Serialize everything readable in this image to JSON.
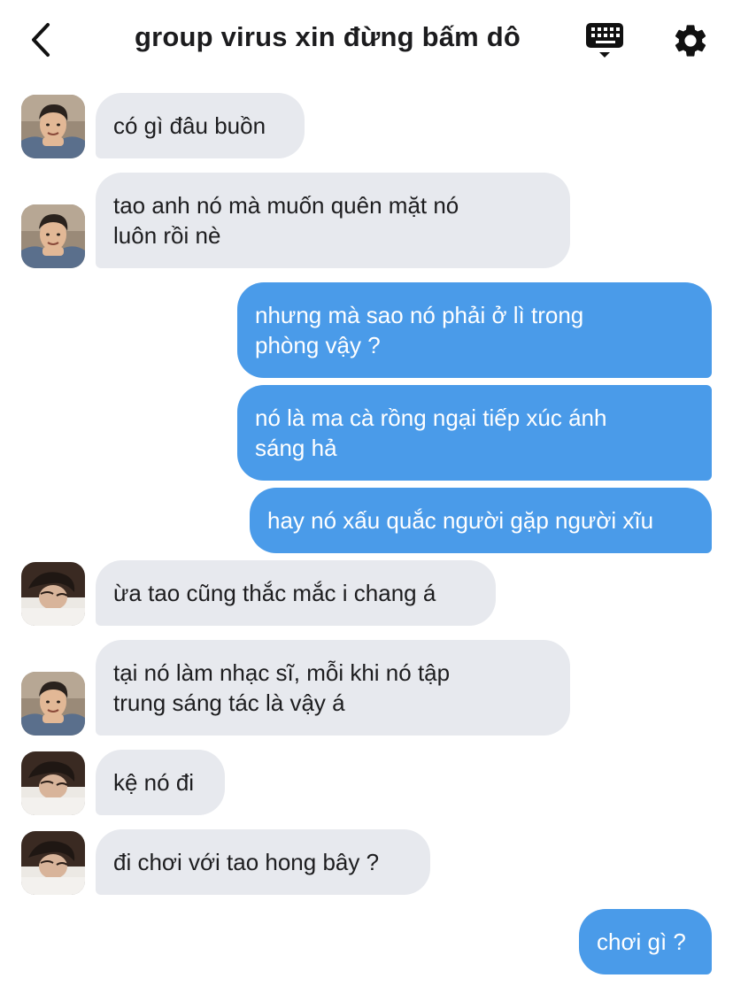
{
  "header": {
    "title": "group virus xin đừng bấm dô",
    "back_icon": "chevron-left-icon",
    "keyboard_icon": "keyboard-icon",
    "settings_icon": "gear-icon"
  },
  "colors": {
    "incoming_bubble": "#e7e9ee",
    "outgoing_bubble": "#4a9be9"
  },
  "messages": [
    {
      "direction": "incoming",
      "sender_avatar": "avatar-a",
      "lines": [
        "có gì đâu buồn"
      ]
    },
    {
      "direction": "incoming",
      "sender_avatar": "avatar-a",
      "lines": [
        "tao anh nó mà muốn quên mặt nó",
        "luôn rồi nè"
      ]
    },
    {
      "direction": "outgoing",
      "lines": [
        "nhưng mà sao nó phải ở lì trong",
        "phòng vậy ?"
      ]
    },
    {
      "direction": "outgoing",
      "lines": [
        "nó là ma cà rồng ngại tiếp xúc ánh",
        "sáng hả"
      ]
    },
    {
      "direction": "outgoing",
      "lines": [
        "hay nó xấu quắc người gặp người xĩu"
      ]
    },
    {
      "direction": "incoming",
      "sender_avatar": "avatar-b",
      "lines": [
        "ừa tao cũng thắc mắc i chang á"
      ]
    },
    {
      "direction": "incoming",
      "sender_avatar": "avatar-a",
      "lines": [
        "tại nó làm nhạc sĩ, mỗi khi nó tập",
        "trung sáng tác là vậy á"
      ]
    },
    {
      "direction": "incoming",
      "sender_avatar": "avatar-b",
      "lines": [
        "kệ nó đi"
      ]
    },
    {
      "direction": "incoming",
      "sender_avatar": "avatar-b",
      "lines": [
        "đi chơi với tao hong bây ?"
      ]
    },
    {
      "direction": "outgoing",
      "lines": [
        "chơi gì ?"
      ]
    }
  ]
}
